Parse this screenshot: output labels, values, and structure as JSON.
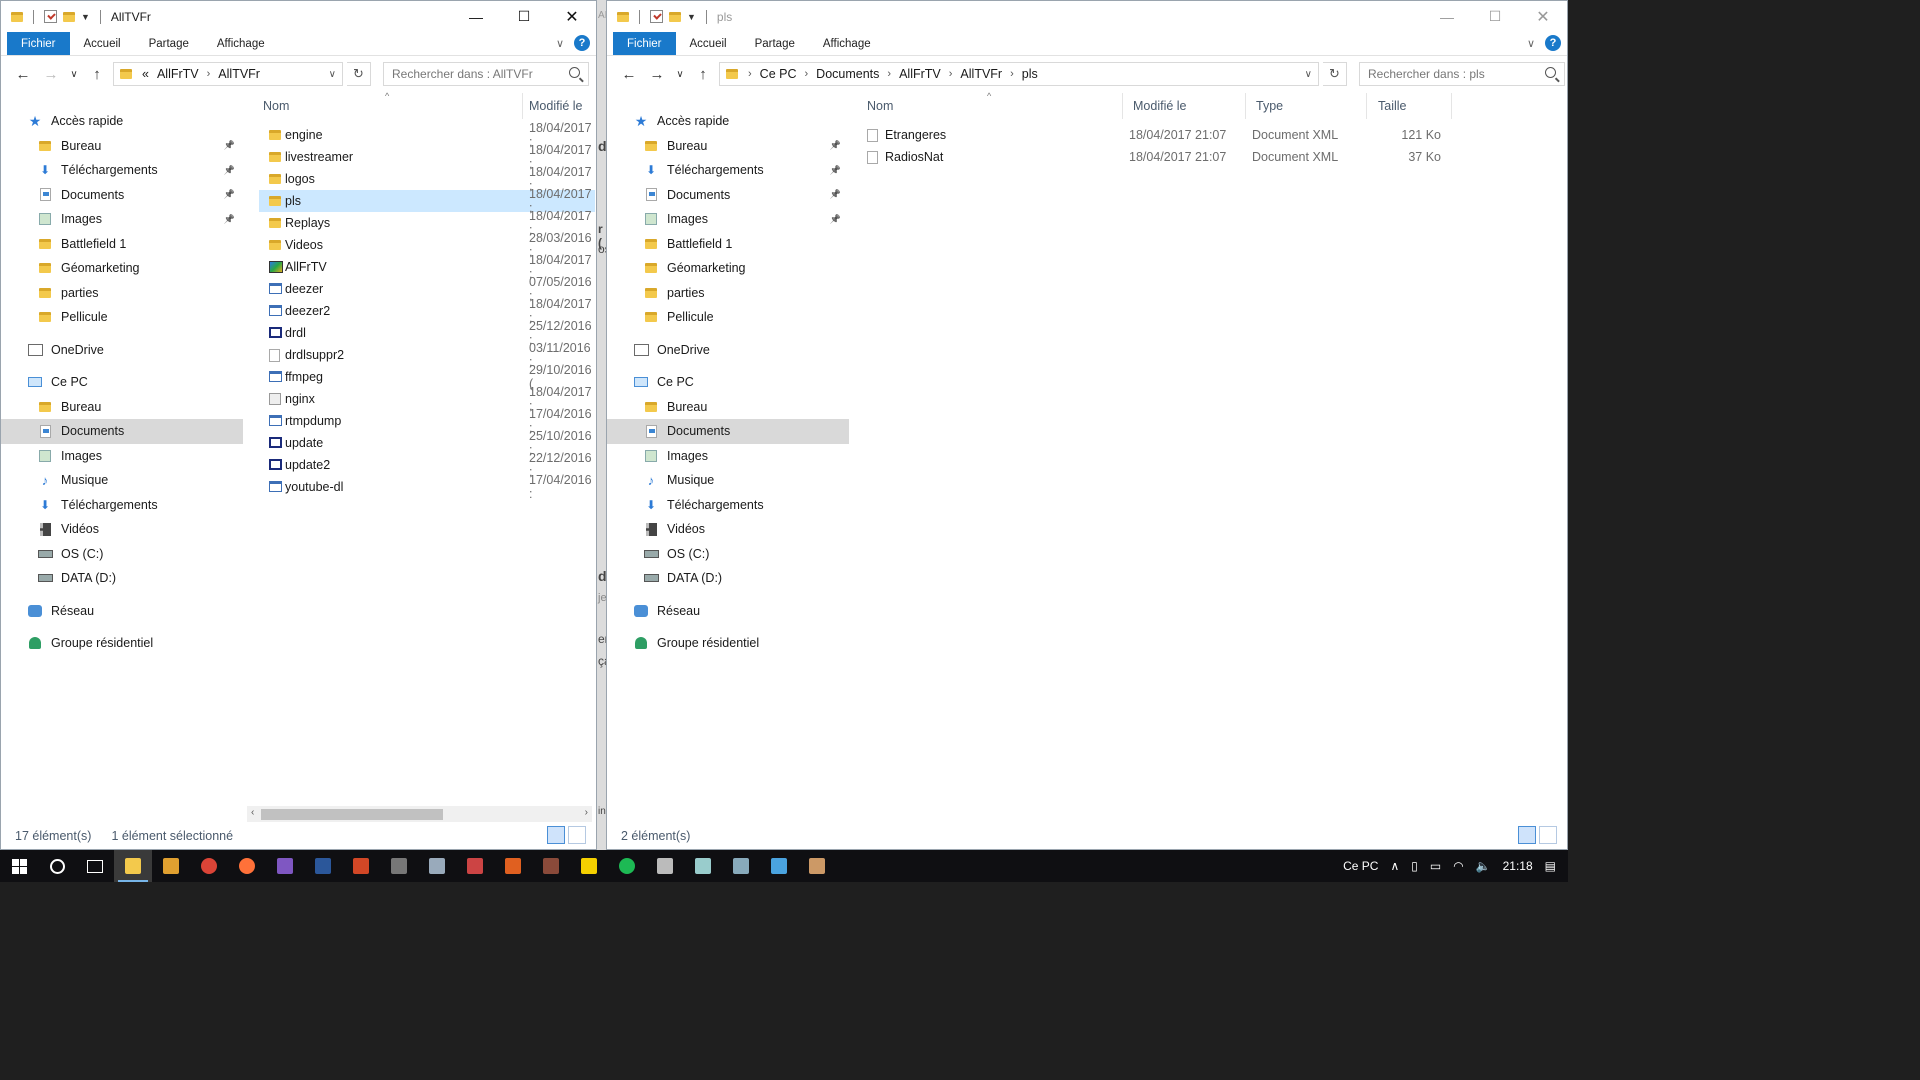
{
  "left_window": {
    "title": "AllTVFr",
    "ribbon_tabs": [
      "Fichier",
      "Accueil",
      "Partage",
      "Affichage"
    ],
    "address": {
      "prefix": "«",
      "crumbs": [
        "AllFrTV",
        "AllTVFr"
      ]
    },
    "search_placeholder": "Rechercher dans : AllTVFr",
    "columns": {
      "name": "Nom",
      "modified": "Modifié le"
    },
    "files": [
      {
        "name": "engine",
        "date": "18/04/2017 :",
        "icon": "folder-icon"
      },
      {
        "name": "livestreamer",
        "date": "18/04/2017 :",
        "icon": "folder-icon"
      },
      {
        "name": "logos",
        "date": "18/04/2017 :",
        "icon": "folder-icon"
      },
      {
        "name": "pls",
        "date": "18/04/2017 :",
        "icon": "folder-icon",
        "selected": true
      },
      {
        "name": "Replays",
        "date": "18/04/2017 :",
        "icon": "folder-icon"
      },
      {
        "name": "Videos",
        "date": "28/03/2016 :",
        "icon": "folder-icon"
      },
      {
        "name": "AllFrTV",
        "date": "18/04/2017 :",
        "icon": "app-icon"
      },
      {
        "name": "deezer",
        "date": "07/05/2016 :",
        "icon": "exe-icon"
      },
      {
        "name": "deezer2",
        "date": "18/04/2017 :",
        "icon": "exe-icon"
      },
      {
        "name": "drdl",
        "date": "25/12/2016 :",
        "icon": "batch-icon"
      },
      {
        "name": "drdlsuppr2",
        "date": "03/11/2016 :",
        "icon": "file-icon"
      },
      {
        "name": "ffmpeg",
        "date": "29/10/2016 (",
        "icon": "exe-icon"
      },
      {
        "name": "nginx",
        "date": "18/04/2017 :",
        "icon": "gear-file-icon"
      },
      {
        "name": "rtmpdump",
        "date": "17/04/2016 :",
        "icon": "exe-icon"
      },
      {
        "name": "update",
        "date": "25/10/2016 :",
        "icon": "batch-icon"
      },
      {
        "name": "update2",
        "date": "22/12/2016 :",
        "icon": "batch-icon"
      },
      {
        "name": "youtube-dl",
        "date": "17/04/2016 :",
        "icon": "exe-icon"
      }
    ],
    "status": {
      "count": "17 élément(s)",
      "selection": "1 élément sélectionné"
    }
  },
  "right_window": {
    "title": "pls",
    "ribbon_tabs": [
      "Fichier",
      "Accueil",
      "Partage",
      "Affichage"
    ],
    "address": {
      "crumbs": [
        "Ce PC",
        "Documents",
        "AllFrTV",
        "AllTVFr",
        "pls"
      ]
    },
    "search_placeholder": "Rechercher dans : pls",
    "columns": {
      "name": "Nom",
      "modified": "Modifié le",
      "type": "Type",
      "size": "Taille"
    },
    "files": [
      {
        "name": "Etrangeres",
        "date": "18/04/2017 21:07",
        "type": "Document XML",
        "size": "121 Ko"
      },
      {
        "name": "RadiosNat",
        "date": "18/04/2017 21:07",
        "type": "Document XML",
        "size": "37 Ko"
      }
    ],
    "status": {
      "count": "2 élément(s)"
    }
  },
  "nav_pane": {
    "quick_access": "Accès rapide",
    "quick_items": [
      {
        "label": "Bureau",
        "pinned": true,
        "icon": "folder-icon"
      },
      {
        "label": "Téléchargements",
        "pinned": true,
        "icon": "download-icon"
      },
      {
        "label": "Documents",
        "pinned": true,
        "icon": "documents-icon"
      },
      {
        "label": "Images",
        "pinned": true,
        "icon": "images-icon"
      },
      {
        "label": "Battlefield 1",
        "pinned": false,
        "icon": "folder-icon"
      },
      {
        "label": "Géomarketing",
        "pinned": false,
        "icon": "folder-icon"
      },
      {
        "label": "parties",
        "pinned": false,
        "icon": "folder-icon"
      },
      {
        "label": "Pellicule",
        "pinned": false,
        "icon": "folder-icon"
      }
    ],
    "onedrive": "OneDrive",
    "this_pc": "Ce PC",
    "pc_items": [
      {
        "label": "Bureau",
        "icon": "folder-icon"
      },
      {
        "label": "Documents",
        "icon": "documents-icon",
        "selected": true
      },
      {
        "label": "Images",
        "icon": "images-icon"
      },
      {
        "label": "Musique",
        "icon": "music-icon"
      },
      {
        "label": "Téléchargements",
        "icon": "download-icon"
      },
      {
        "label": "Vidéos",
        "icon": "videos-icon"
      },
      {
        "label": "OS (C:)",
        "icon": "drive-icon"
      },
      {
        "label": "DATA (D:)",
        "icon": "drive-icon"
      }
    ],
    "network": "Réseau",
    "homegroup": "Groupe résidentiel"
  },
  "between_windows_fragments": [
    "AII",
    "d",
    "r (",
    "os",
    "d",
    "je",
    "em",
    "ça",
    "in"
  ],
  "taskbar": {
    "tray_label": "Ce PC",
    "time": "21:18",
    "pinned_apps": [
      {
        "name": "file-explorer-icon",
        "color": "#f3c94c"
      },
      {
        "name": "media-player-icon",
        "color": "#e0a030"
      },
      {
        "name": "chrome-icon",
        "color": "#db4437"
      },
      {
        "name": "firefox-icon",
        "color": "#ff7139"
      },
      {
        "name": "visual-studio-icon",
        "color": "#7f57c2"
      },
      {
        "name": "word-icon",
        "color": "#2b579a"
      },
      {
        "name": "powerpoint-icon",
        "color": "#d24726"
      },
      {
        "name": "calculator-icon",
        "color": "#777777"
      },
      {
        "name": "app-icon-1",
        "color": "#9ab"
      },
      {
        "name": "app-icon-2",
        "color": "#c44"
      },
      {
        "name": "app-icon-3",
        "color": "#e06020"
      },
      {
        "name": "app-icon-4",
        "color": "#8a4a3a"
      },
      {
        "name": "app-icon-17",
        "color": "#f5d000"
      },
      {
        "name": "spotify-icon",
        "color": "#1db954"
      },
      {
        "name": "app-icon-5",
        "color": "#bbb"
      },
      {
        "name": "app-icon-6",
        "color": "#9cc"
      },
      {
        "name": "app-icon-7",
        "color": "#8ab"
      },
      {
        "name": "app-icon-8",
        "color": "#4aa3df"
      },
      {
        "name": "app-icon-9",
        "color": "#c96"
      }
    ]
  }
}
